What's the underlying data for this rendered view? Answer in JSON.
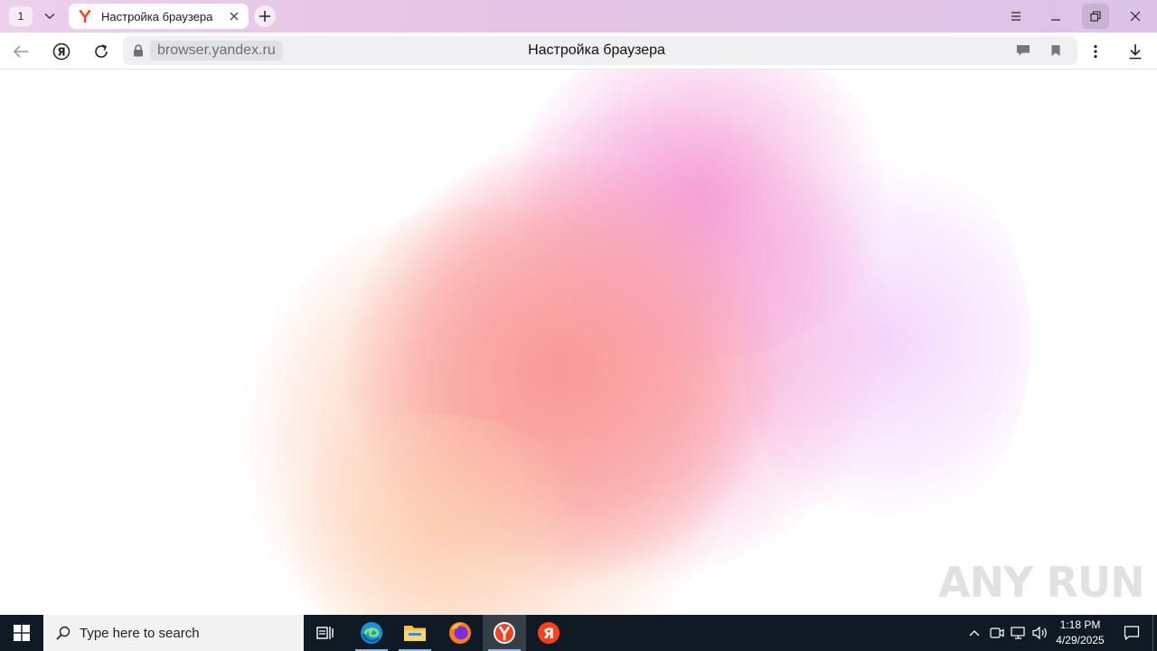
{
  "browser": {
    "tab_counter": "1",
    "tab": {
      "title": "Настройка браузера",
      "favicon": "yandex-y-icon"
    },
    "address": {
      "domain": "browser.yandex.ru",
      "page_title": "Настройка браузера"
    },
    "window_buttons": [
      "menu-icon",
      "minimize-icon",
      "restore-icon",
      "close-icon"
    ],
    "toolbar_icons": [
      "back-icon",
      "yandex-icon",
      "reload-icon",
      "lock-icon",
      "comment-icon",
      "bookmark-icon",
      "more-icon",
      "download-icon"
    ]
  },
  "content": {
    "watermark": "ANY RUN"
  },
  "taskbar": {
    "search_placeholder": "Type here to search",
    "apps": [
      "task-view-icon",
      "edge-icon",
      "file-explorer-icon",
      "firefox-icon",
      "yandex-browser-icon",
      "yandex-icon"
    ],
    "active_app": "yandex-browser-icon",
    "clock": {
      "time": "1:18 PM",
      "date": "4/29/2025"
    }
  },
  "colors": {
    "titlebar": "#e4c4e4",
    "taskbar": "#101a25",
    "yandex_red": "#fc3f1d"
  }
}
